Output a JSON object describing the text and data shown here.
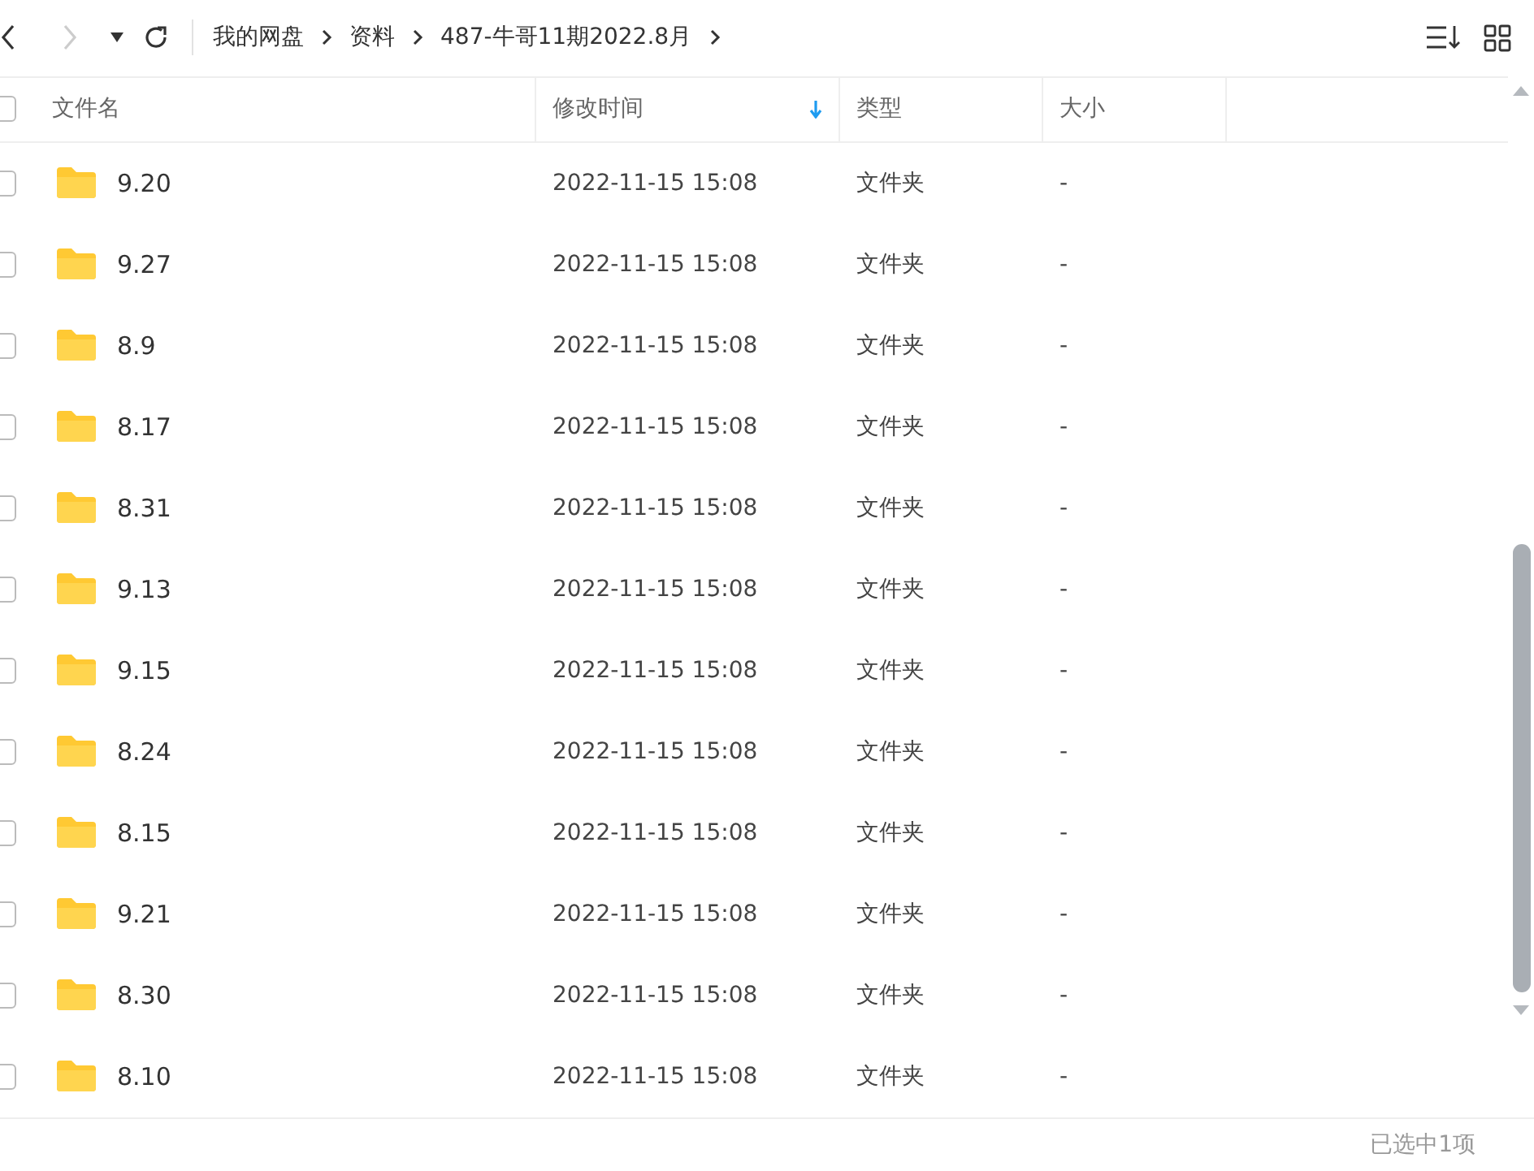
{
  "breadcrumb": [
    "我的网盘",
    "资料",
    "487-牛哥11期2022.8月"
  ],
  "columns": [
    {
      "label": "文件名",
      "sorted": false
    },
    {
      "label": "修改时间",
      "sorted": true
    },
    {
      "label": "类型",
      "sorted": false
    },
    {
      "label": "大小",
      "sorted": false
    }
  ],
  "rows": [
    {
      "name": "9.20",
      "modified": "2022-11-15 15:08",
      "type": "文件夹",
      "size": "-",
      "checked": false
    },
    {
      "name": "9.27",
      "modified": "2022-11-15 15:08",
      "type": "文件夹",
      "size": "-",
      "checked": false
    },
    {
      "name": "8.9",
      "modified": "2022-11-15 15:08",
      "type": "文件夹",
      "size": "-",
      "checked": false
    },
    {
      "name": "8.17",
      "modified": "2022-11-15 15:08",
      "type": "文件夹",
      "size": "-",
      "checked": false
    },
    {
      "name": "8.31",
      "modified": "2022-11-15 15:08",
      "type": "文件夹",
      "size": "-",
      "checked": false
    },
    {
      "name": "9.13",
      "modified": "2022-11-15 15:08",
      "type": "文件夹",
      "size": "-",
      "checked": false
    },
    {
      "name": "9.15",
      "modified": "2022-11-15 15:08",
      "type": "文件夹",
      "size": "-",
      "checked": false
    },
    {
      "name": "8.24",
      "modified": "2022-11-15 15:08",
      "type": "文件夹",
      "size": "-",
      "checked": false
    },
    {
      "name": "8.15",
      "modified": "2022-11-15 15:08",
      "type": "文件夹",
      "size": "-",
      "checked": false
    },
    {
      "name": "9.21",
      "modified": "2022-11-15 15:08",
      "type": "文件夹",
      "size": "-",
      "checked": false
    },
    {
      "name": "8.30",
      "modified": "2022-11-15 15:08",
      "type": "文件夹",
      "size": "-",
      "checked": false
    },
    {
      "name": "8.10",
      "modified": "2022-11-15 15:08",
      "type": "文件夹",
      "size": "-",
      "checked": false
    }
  ],
  "select_all_checked": false,
  "status_bar": "已选中1项"
}
